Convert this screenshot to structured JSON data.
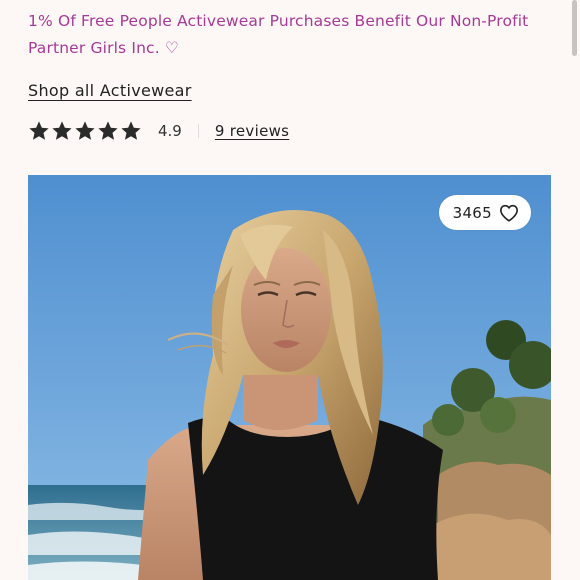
{
  "promo": {
    "text": "1% Of Free People Activewear Purchases Benefit Our Non-Profit Partner Girls Inc. ♡"
  },
  "shop_link": {
    "label": "Shop all Activewear"
  },
  "rating": {
    "stars": 5,
    "value": "4.9",
    "reviews_label": "9 reviews"
  },
  "photo": {
    "likes": "3465",
    "like_icon": "heart-outline-icon"
  },
  "colors": {
    "background": "#fdf8f5",
    "promo_text": "#a63a96",
    "star": "#2b2b2b",
    "sky": "#5f9ad4"
  }
}
